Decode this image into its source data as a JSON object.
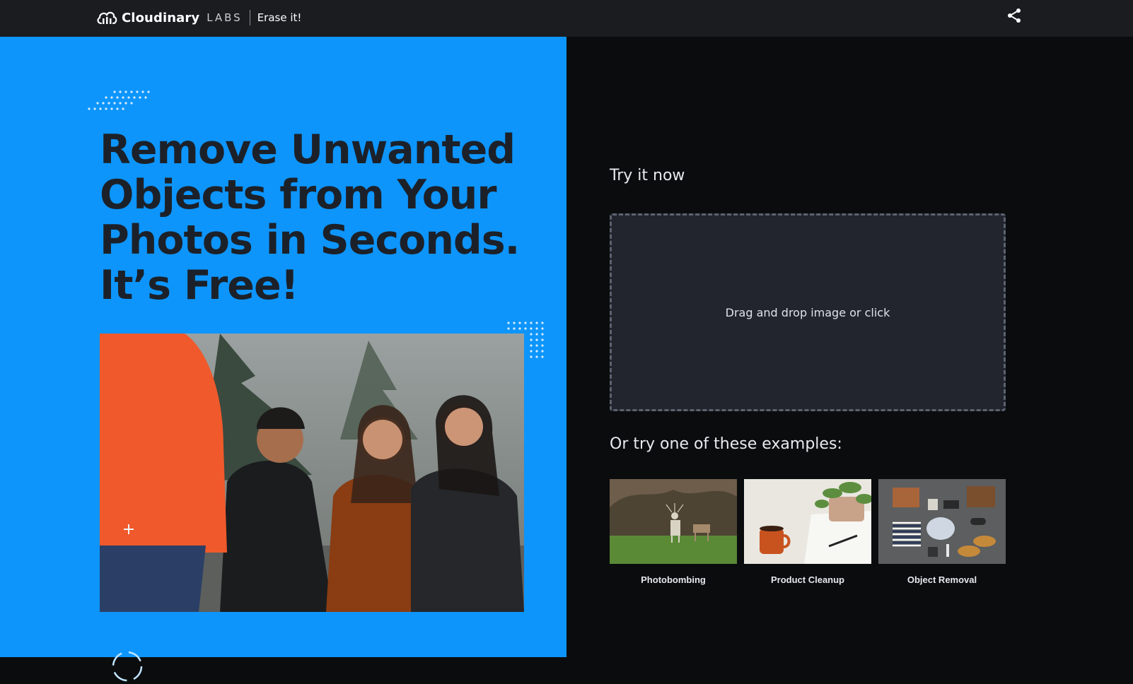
{
  "header": {
    "brand_name": "Cloudinary",
    "brand_sub": "LABS",
    "product_name": "Erase it!",
    "share_icon": "share-icon"
  },
  "hero": {
    "title": "Remove Unwanted Objects from Your Photos in Seconds. It’s Free!",
    "background": "#0d95fc",
    "title_color": "#1c2129"
  },
  "main": {
    "try_label": "Try it now",
    "dropzone_text": "Drag and drop image or click",
    "examples_label": "Or try one of these examples:",
    "examples": [
      {
        "label": "Photobombing",
        "image": "deer-on-grass-image"
      },
      {
        "label": "Product Cleanup",
        "image": "coffee-mug-and-notebook-image"
      },
      {
        "label": "Object Removal",
        "image": "flat-lay-items-image"
      }
    ]
  }
}
